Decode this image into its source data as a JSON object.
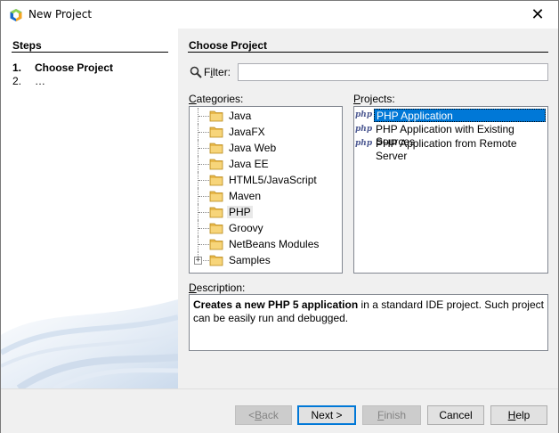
{
  "window": {
    "title": "New Project",
    "close_glyph": "✕"
  },
  "steps": {
    "header": "Steps",
    "items": [
      {
        "num": "1.",
        "label": "Choose Project",
        "active": true
      },
      {
        "num": "2.",
        "label": "…",
        "active": false
      }
    ]
  },
  "main": {
    "header": "Choose Project",
    "filter": {
      "label_prefix": "F",
      "label_underlined": "i",
      "label_suffix": "lter:",
      "value": "",
      "icon": "search-icon"
    },
    "categories": {
      "label_prefix": "",
      "label_underlined": "C",
      "label_suffix": "ategories:",
      "items": [
        {
          "label": "Java",
          "expandable": false,
          "selected": false
        },
        {
          "label": "JavaFX",
          "expandable": false,
          "selected": false
        },
        {
          "label": "Java Web",
          "expandable": false,
          "selected": false
        },
        {
          "label": "Java EE",
          "expandable": false,
          "selected": false
        },
        {
          "label": "HTML5/JavaScript",
          "expandable": false,
          "selected": false
        },
        {
          "label": "Maven",
          "expandable": false,
          "selected": false
        },
        {
          "label": "PHP",
          "expandable": false,
          "selected": true
        },
        {
          "label": "Groovy",
          "expandable": false,
          "selected": false
        },
        {
          "label": "NetBeans Modules",
          "expandable": false,
          "selected": false
        },
        {
          "label": "Samples",
          "expandable": true,
          "selected": false
        }
      ]
    },
    "projects": {
      "label_prefix": "",
      "label_underlined": "P",
      "label_suffix": "rojects:",
      "icon_text": "php",
      "items": [
        {
          "label": "PHP Application",
          "selected": true
        },
        {
          "label": "PHP Application with Existing Sources",
          "selected": false
        },
        {
          "label": "PHP Application from Remote Server",
          "selected": false
        }
      ]
    },
    "description": {
      "label_prefix": "",
      "label_underlined": "D",
      "label_suffix": "escription:",
      "bold": "Creates a new PHP 5 application",
      "rest": " in a standard IDE project. Such project can be easily run and debugged."
    }
  },
  "buttons": {
    "back": {
      "prefix": "< ",
      "underlined": "B",
      "suffix": "ack",
      "enabled": false
    },
    "next": {
      "prefix": "Next >",
      "underlined": "",
      "suffix": "",
      "enabled": true
    },
    "finish": {
      "prefix": "",
      "underlined": "F",
      "suffix": "inish",
      "enabled": false
    },
    "cancel": {
      "prefix": "Cancel",
      "underlined": "",
      "suffix": "",
      "enabled": true
    },
    "help": {
      "prefix": "",
      "underlined": "H",
      "suffix": "elp",
      "enabled": true
    }
  },
  "colors": {
    "selection": "#0078d7",
    "folder": "#e8b84a",
    "php": "#4f5b93"
  }
}
